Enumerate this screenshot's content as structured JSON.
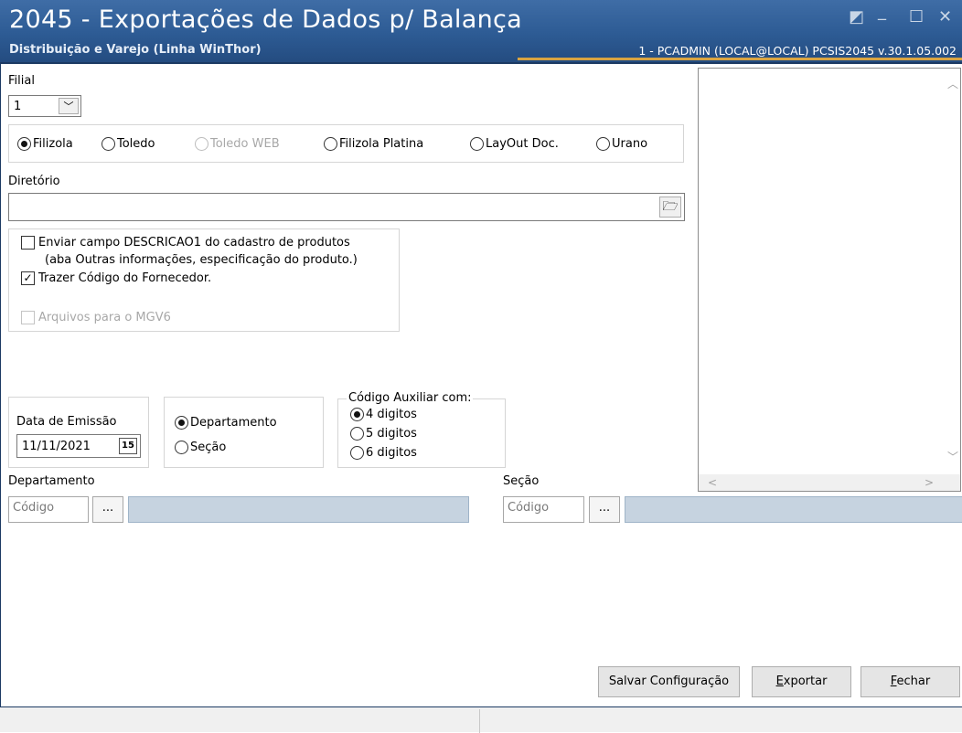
{
  "window": {
    "title": "2045 - Exportações de Dados p/ Balança",
    "subtitle": "Distribuição e Varejo (Linha WinThor)",
    "user_info": "1 - PCADMIN (LOCAL@LOCAL)   PCSIS2045  v.30.1.05.002",
    "controls": {
      "restore": "◩",
      "minimize": "_",
      "maximize": "☐",
      "close": "✕"
    }
  },
  "filial": {
    "label": "Filial",
    "value": "1",
    "dropdown_glyph": "﹀"
  },
  "balanca": {
    "options": [
      {
        "label": "Filizola",
        "checked": true,
        "disabled": false
      },
      {
        "label": "Toledo",
        "checked": false,
        "disabled": false
      },
      {
        "label": "Toledo WEB",
        "checked": false,
        "disabled": true
      },
      {
        "label": "Filizola Platina",
        "checked": false,
        "disabled": false
      },
      {
        "label": "LayOut Doc.",
        "checked": false,
        "disabled": false
      },
      {
        "label": "Urano",
        "checked": false,
        "disabled": false
      }
    ]
  },
  "diretorio": {
    "label": "Diretório",
    "value": "",
    "folder_glyph": "🗁"
  },
  "checks": {
    "descricao1_line1": "Enviar campo DESCRICAO1 do cadastro de produtos",
    "descricao1_line2": "(aba Outras informações, especificação do produto.)",
    "descricao1_checked": false,
    "fornecedor": "Trazer Código do Fornecedor.",
    "fornecedor_checked": true,
    "mgv6": "Arquivos para o MGV6",
    "mgv6_checked": false,
    "check_glyph": "✓"
  },
  "data_emissao": {
    "label": "Data de Emissão",
    "value": "11/11/2021",
    "cal_label": "15"
  },
  "agrupamento": {
    "departamento": "Departamento",
    "departamento_checked": true,
    "secao": "Seção",
    "secao_checked": false
  },
  "codigo_auxiliar": {
    "label": "Código Auxiliar com:",
    "options": [
      {
        "label": "4 digitos",
        "checked": true
      },
      {
        "label": "5 digitos",
        "checked": false
      },
      {
        "label": "6 digitos",
        "checked": false
      }
    ]
  },
  "departamento_filter": {
    "label": "Departamento",
    "placeholder": "Código",
    "dots": "...",
    "description": ""
  },
  "secao_filter": {
    "label": "Seção",
    "placeholder": "Código",
    "dots": "...",
    "description": ""
  },
  "right_panel": {
    "up": "︿",
    "down": "﹀",
    "left": "<",
    "right": ">"
  },
  "buttons": {
    "salvar": "Salvar Configuração",
    "exportar_first": "E",
    "exportar_rest": "xportar",
    "fechar_first": "F",
    "fechar_rest": "echar"
  },
  "statusbar": {
    "left": "",
    "right": ""
  }
}
